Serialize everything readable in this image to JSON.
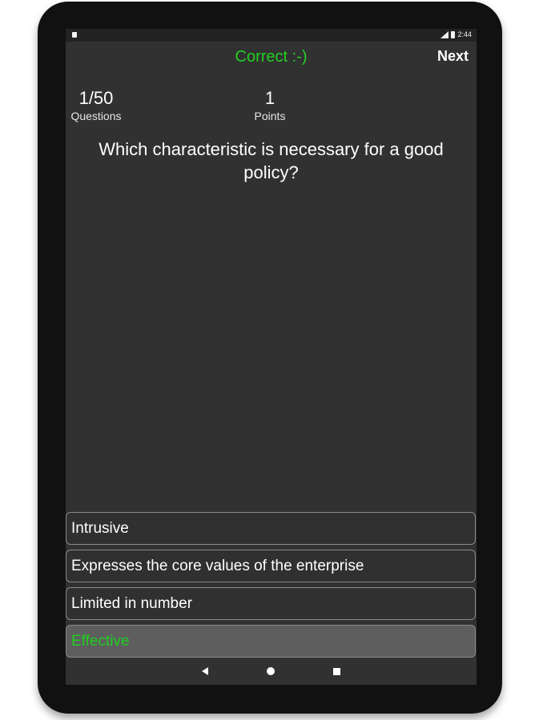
{
  "status_bar": {
    "time": "2:44"
  },
  "header": {
    "result": "Correct :-)",
    "next_label": "Next",
    "result_color": "#22d022"
  },
  "stats": {
    "questions_value": "1/50",
    "questions_label": "Questions",
    "points_value": "1",
    "points_label": "Points"
  },
  "question": {
    "text": "Which characteristic is necessary for a good policy?"
  },
  "answers": [
    {
      "label": "Intrusive"
    },
    {
      "label": "Expresses the core values of the enterprise"
    },
    {
      "label": "Limited in number"
    },
    {
      "label": "Effective",
      "selected": true,
      "color": "#1fd01f"
    }
  ],
  "navigation": {
    "back_icon": "back-icon",
    "home_icon": "home-icon",
    "recent_icon": "recent-apps-icon"
  }
}
